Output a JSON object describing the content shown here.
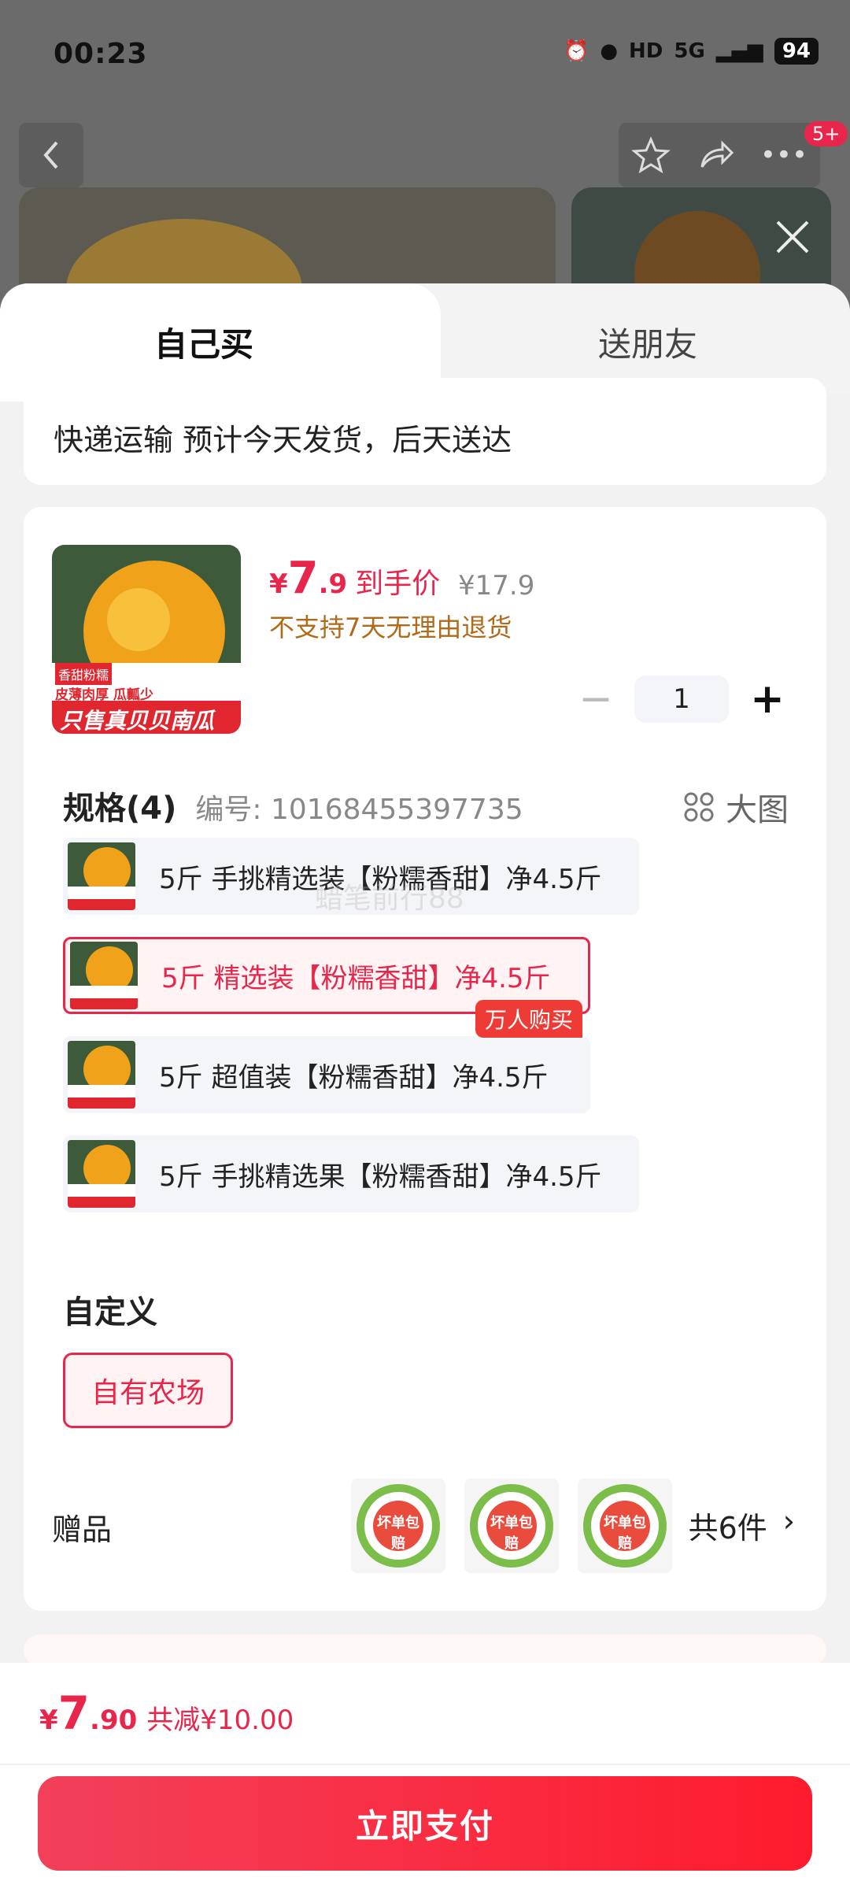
{
  "status_bar": {
    "time": "00:23",
    "network": "5G",
    "battery": "94"
  },
  "top_bar": {
    "badge": "5+"
  },
  "tabs": {
    "self": "自己买",
    "gift": "送朋友"
  },
  "delivery": {
    "text": "快递运输 预计今天发货，后天送达"
  },
  "product": {
    "thumb_line1": "香甜粉糯",
    "thumb_line2": "皮薄肉厚 瓜瓤少",
    "thumb_banner": "只售真贝贝南瓜",
    "price_symbol": "¥",
    "price_int": "7",
    "price_dec": ".9",
    "price_label": "到手价",
    "original_price": "¥17.9",
    "return_policy": "不支持7天无理由退货",
    "quantity": "1"
  },
  "spec": {
    "title": "规格(4)",
    "code": "编号: 10168455397735",
    "big_image": "大图",
    "options": [
      {
        "label": "5斤 手挑精选装【粉糯香甜】净4.5斤"
      },
      {
        "label": "5斤 精选装【粉糯香甜】净4.5斤"
      },
      {
        "label": "5斤 超值装【粉糯香甜】净4.5斤"
      },
      {
        "label": "5斤 手挑精选果【粉糯香甜】净4.5斤"
      }
    ],
    "hot_tag": "万人购买",
    "watermark": "蜡笔前行88"
  },
  "custom": {
    "title": "自定义",
    "option": "自有农场"
  },
  "gift": {
    "title": "赠品",
    "badge_text": "坏单包赔",
    "count": "共6件"
  },
  "footer": {
    "symbol": "¥",
    "total_int": "7",
    "total_dec": ".90",
    "reduction": "共减¥10.00",
    "pay_button": "立即支付"
  },
  "colors": {
    "accent": "#e8264b",
    "button": "#ff1b2d"
  }
}
